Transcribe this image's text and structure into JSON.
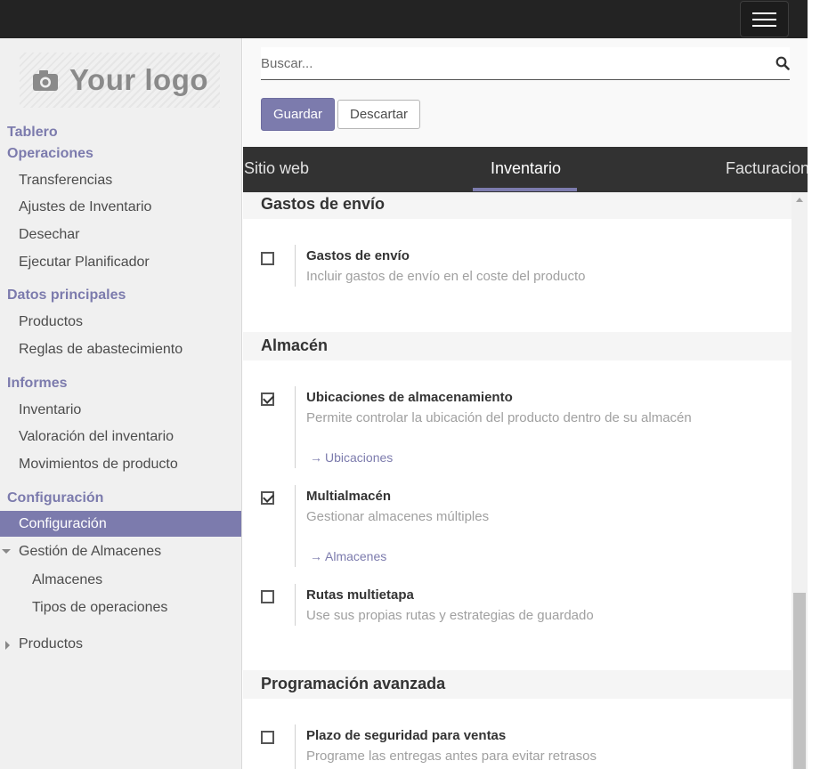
{
  "topbar": {
    "menu_icon": "hamburger-menu-icon"
  },
  "sidebar": {
    "logo_text": "Your logo",
    "logo_icon": "camera-icon",
    "headings": [
      "Tablero",
      "Operaciones",
      "Datos principales",
      "Informes",
      "Configuración"
    ],
    "operaciones_items": [
      "Transferencias",
      "Ajustes de Inventario",
      "Desechar",
      "Ejecutar Planificador"
    ],
    "datos_items": [
      "Productos",
      "Reglas de abastecimiento"
    ],
    "informes_items": [
      "Inventario",
      "Valoración del inventario",
      "Movimientos de producto"
    ],
    "config_active": "Configuración",
    "gestion": "Gestión de Almacenes",
    "gestion_items": [
      "Almacenes",
      "Tipos de operaciones"
    ],
    "productos": "Productos"
  },
  "search": {
    "placeholder": "Buscar..."
  },
  "buttons": {
    "save": "Guardar",
    "discard": "Descartar"
  },
  "tabs": [
    "Sitio web",
    "Inventario",
    "Facturacion"
  ],
  "sections": {
    "shipping": {
      "title": "Gastos de envío",
      "setting": {
        "title": "Gastos de envío",
        "desc": "Incluir gastos de envío en el coste del producto",
        "checked": false
      }
    },
    "warehouse": {
      "title": "Almacén",
      "locations": {
        "title": "Ubicaciones de almacenamiento",
        "desc": "Permite controlar la ubicación del producto dentro de su almacén",
        "link": "Ubicaciones",
        "checked": true
      },
      "multi": {
        "title": "Multialmacén",
        "desc": "Gestionar almacenes múltiples",
        "link": "Almacenes",
        "checked": true
      },
      "routes": {
        "title": "Rutas multietapa",
        "desc": "Use sus propias rutas y estrategias de guardado",
        "checked": false
      }
    },
    "advanced": {
      "title": "Programación avanzada",
      "security": {
        "title": "Plazo de seguridad para ventas",
        "desc": "Programe las entregas antes para evitar retrasos",
        "checked": false
      }
    }
  },
  "colors": {
    "accent": "#7c7bad",
    "topbar": "#232323",
    "tabbar": "#323232"
  }
}
